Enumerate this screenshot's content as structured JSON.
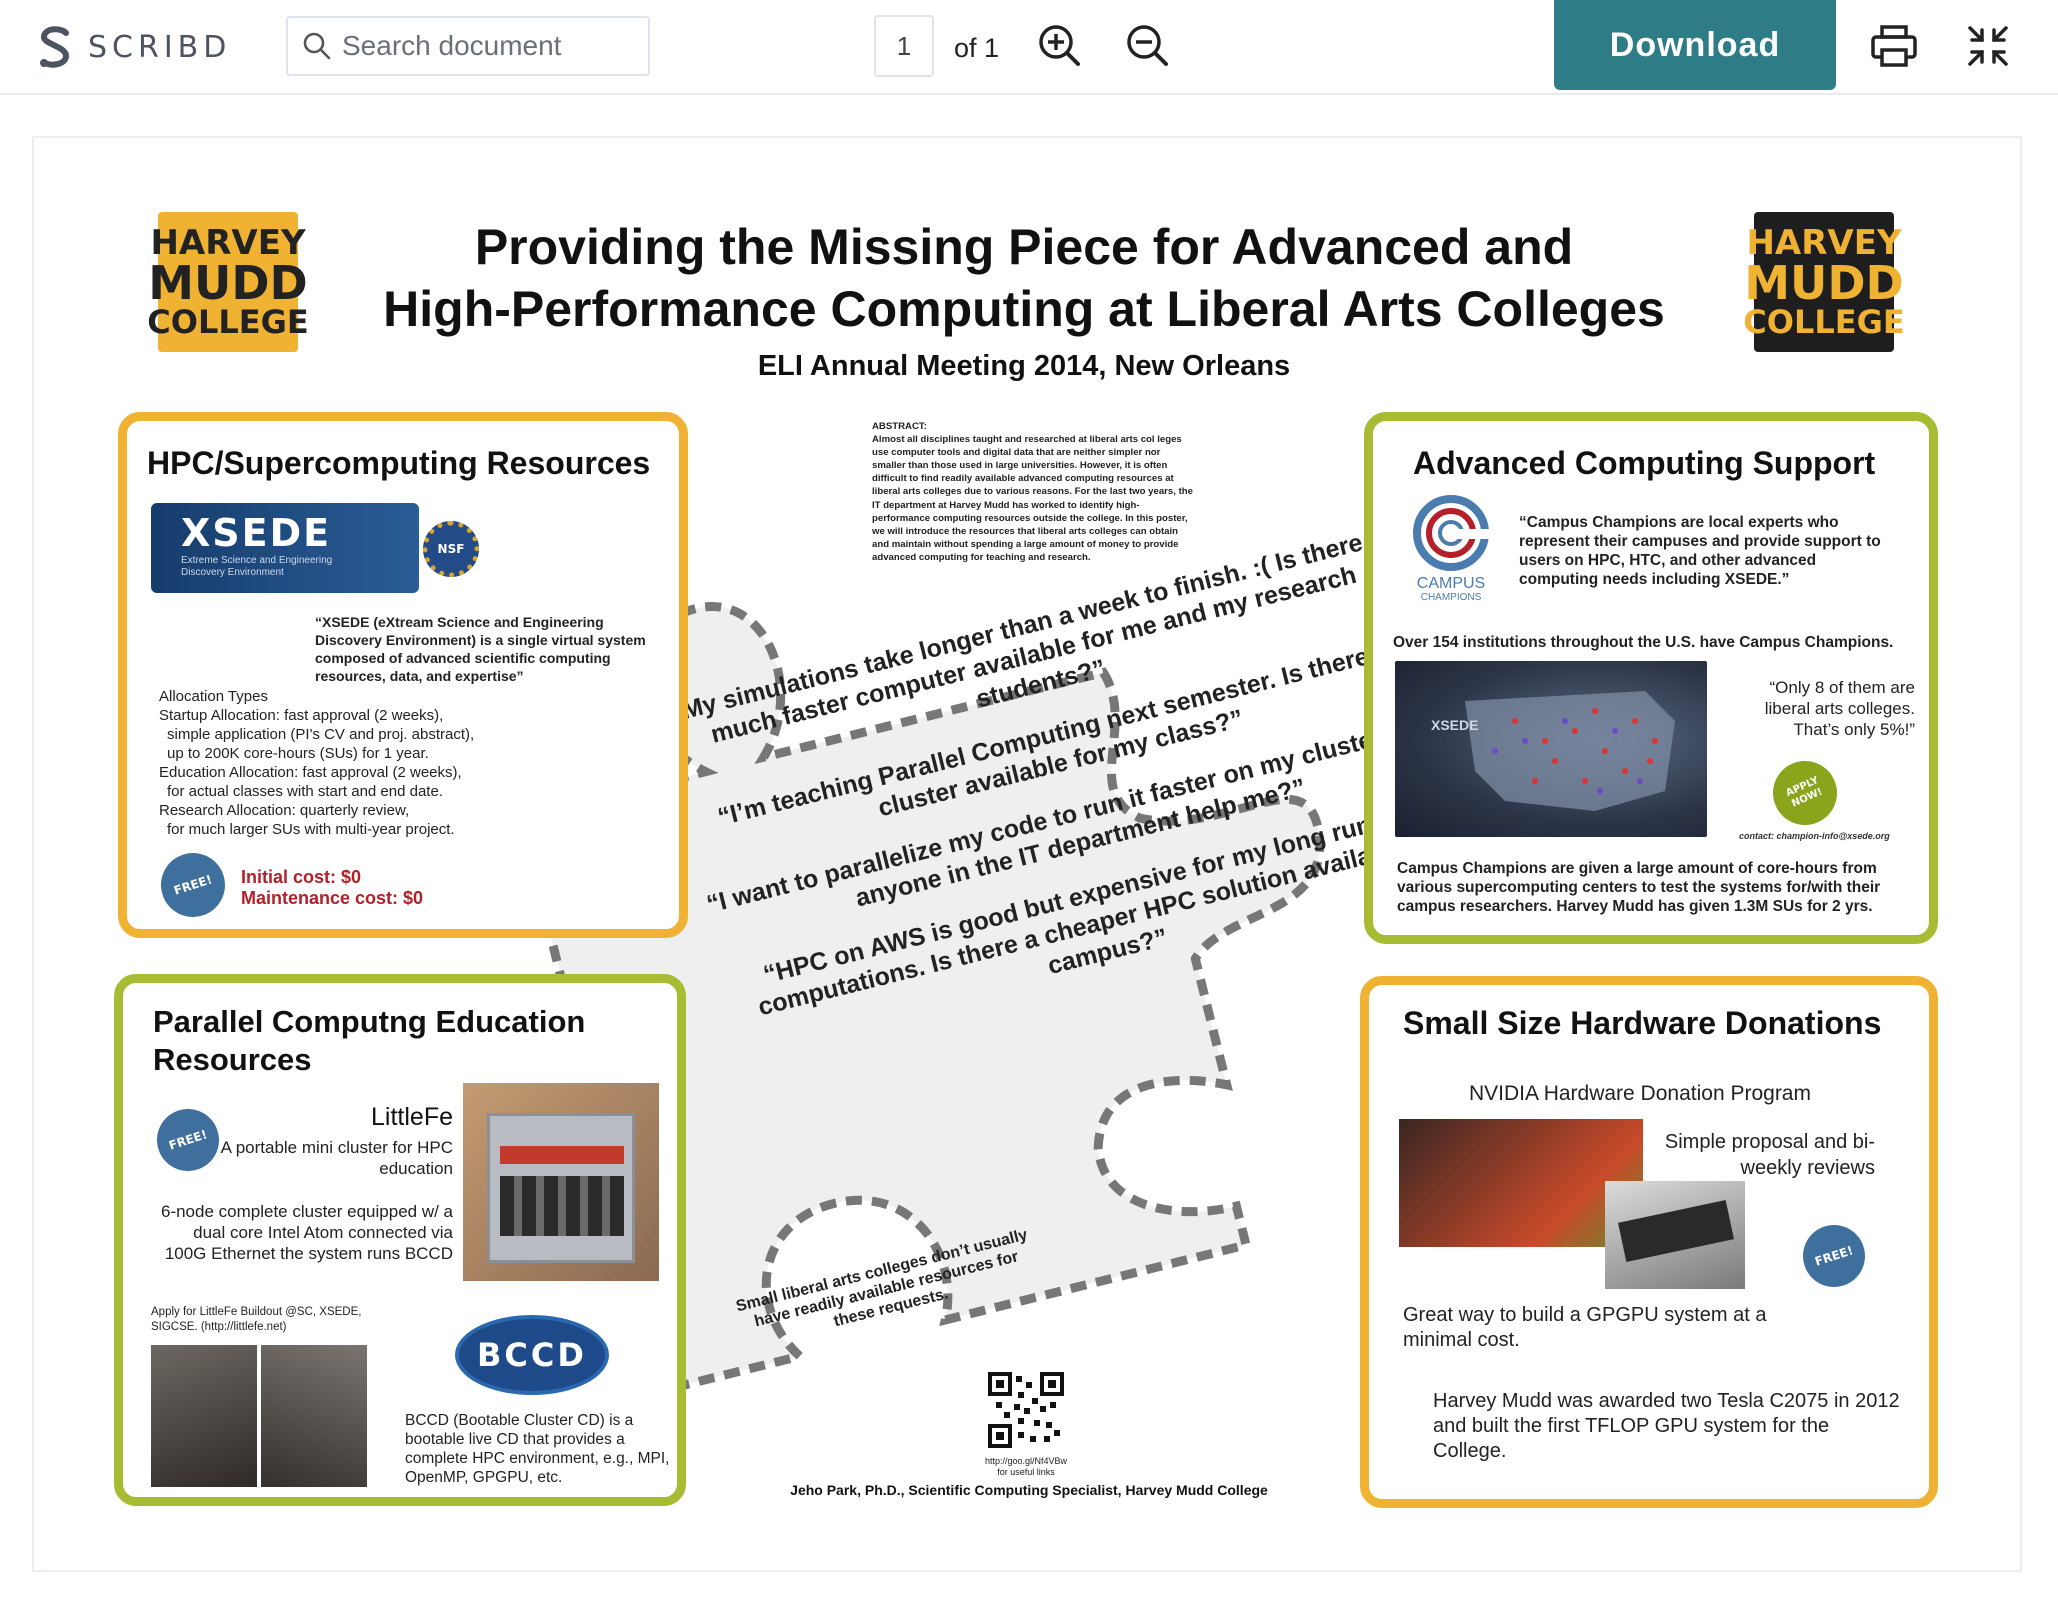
{
  "toolbar": {
    "brand": "SCRIBD",
    "search_placeholder": "Search document",
    "page_current": "1",
    "page_of": "of 1",
    "download_label": "Download"
  },
  "poster": {
    "logo_left": {
      "line1": "HARVEY",
      "line2": "MUDD",
      "line3": "COLLEGE"
    },
    "logo_right": {
      "line1": "HARVEY",
      "line2": "MUDD",
      "line3": "COLLEGE"
    },
    "title_line1": "Providing the Missing Piece for Advanced and",
    "title_line2": "High-Performance Computing at Liberal Arts Colleges",
    "subtitle": "ELI Annual Meeting 2014, New Orleans",
    "abstract": {
      "heading": "ABSTRACT:",
      "text": "Almost all disciplines taught and researched at liberal arts col leges use computer tools and digital data that are neither simpler nor smaller than those used in large universities. However, it is often difficult to find readily available advanced computing resources at liberal arts colleges due to various reasons. For the last two years, the IT department at Harvey Mudd has worked to identify high-performance computing resources outside the college. In this poster, we will introduce the resources that liberal arts colleges can obtain and maintain without spending a large amount of money to provide advanced computing for teaching and research."
    },
    "hpc": {
      "heading": "HPC/Supercomputing Resources",
      "xsede_logo": "XSEDE",
      "xsede_tagline": "Extreme Science and Engineering Discovery Environment",
      "nsf": "NSF",
      "xsede_quote": "“XSEDE (eXtream Science and Engineering Discovery Environment) is a single virtual system composed of advanced scientific computing resources, data, and expertise”",
      "alloc_heading": "Allocation Types",
      "alloc_1": "Startup Allocation: fast approval (2 weeks),",
      "alloc_1b": "simple application (PI's CV and proj. abstract),",
      "alloc_1c": "up to 200K core-hours (SUs) for 1  year.",
      "alloc_2": "Education Allocation: fast approval (2 weeks),",
      "alloc_2b": "for actual classes with start and end date.",
      "alloc_3": "Research  Allocation:  quarterly  review,",
      "alloc_3b": "for much larger SUs with multi-year project.",
      "free": "FREE!",
      "initial_cost": "Initial cost: $0",
      "maintenance_cost": "Maintenance cost: $0"
    },
    "acs": {
      "heading": "Advanced Computing Support",
      "campus_logo_line1": "CAMPUS",
      "campus_logo_line2": "CHAMPIONS",
      "quote": "“Campus Champions are local experts who represent their campuses and provide support to users on HPC, HTC, and other advanced computing needs including XSEDE.”",
      "over": "Over 154 institutions throughout the U.S. have Campus Champions.",
      "map_label": "XSEDE",
      "only8": "“Only 8 of them are liberal arts colleges. That’s only 5%!”",
      "apply_now": "APPLY NOW!",
      "contact": "contact: champion-info@xsede.org",
      "given": "Campus Champions are given a large amount of core-hours from various supercomputing centers to test the systems for/with their campus researchers. Harvey Mudd has given  1.3M SUs for 2 yrs."
    },
    "pce": {
      "heading": "Parallel Computng Education Resources",
      "free": "FREE!",
      "littlefe": "LittleFe",
      "littlefe_desc": "A portable mini cluster for HPC education",
      "littlefe_spec": "6-node complete cluster equipped w/ a dual core Intel Atom connected via 100G Ethernet the system runs BCCD",
      "apply": "Apply for LittleFe Buildout @SC, XSEDE, SIGCSE. (http://littlefe.net)",
      "bccd_logo": "BCCD",
      "bccd_desc": "BCCD (Bootable Cluster CD) is a bootable live CD that provides a complete HPC environment, e.g., MPI, OpenMP, GPGPU, etc."
    },
    "hw": {
      "heading": "Small Size Hardware Donations",
      "program": "NVIDIA Hardware Donation Program",
      "simple": "Simple proposal and bi-weekly reviews",
      "free": "FREE!",
      "great": "Great way to build a GPGPU system at a minimal cost.",
      "awarded": "Harvey Mudd was awarded two Tesla C2075 in 2012 and built the first TFLOP GPU system for the College."
    },
    "quotes": [
      "“My simulations take longer than a week to finish. :( Is there a much faster computer available for me and my research students?”",
      "“I’m teaching Parallel Computing next semester. Is there a cluster available for my class?”",
      "“I want to parallelize my code to run it faster on my cluster. Can anyone in the IT department help me?”",
      "“HPC on AWS is good but expensive for my long running computations. Is there a cheaper HPC solution available on campus?”"
    ],
    "small_colleges": "Small liberal arts colleges don’t usually have readily available resources for these requests.",
    "qr_link": "http://goo.gl/Nf4VBw",
    "qr_caption": "for useful links",
    "author": "Jeho Park, Ph.D., Scientific Computing Specialist, Harvey Mudd  College"
  },
  "colors": {
    "accent": "#2e7d86",
    "orange": "#f0b232",
    "green": "#a7bb33",
    "red": "#b3202a"
  }
}
